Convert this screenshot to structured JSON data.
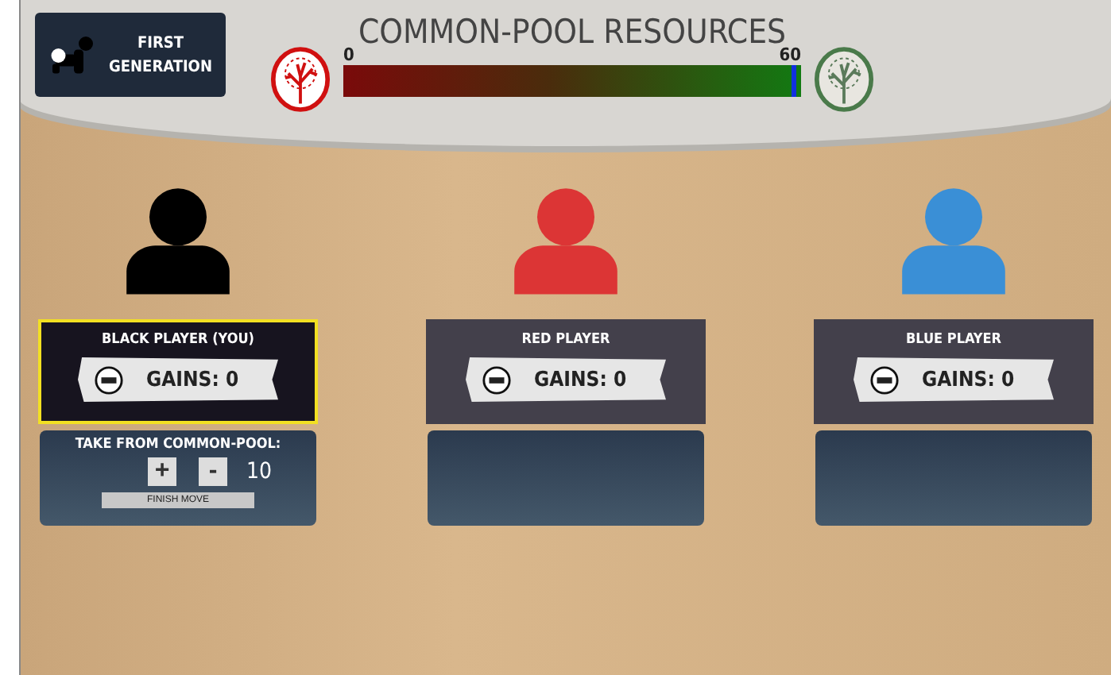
{
  "badge": {
    "title": "FIRST GENERATION"
  },
  "header": {
    "title": "COMMON-POOL RESOURCES",
    "min_label": "0",
    "max_label": "60",
    "level": 0.99
  },
  "players": [
    {
      "name": "BLACK PLAYER (YOU)",
      "gains": "GAINS: 0",
      "color": "#000000",
      "selected": true,
      "controls": {
        "label": "TAKE FROM COMMON-POOL:",
        "plus": "+",
        "minus": "-",
        "amount": "10",
        "finish": "FINISH MOVE"
      }
    },
    {
      "name": "RED PLAYER",
      "gains": "GAINS: 0",
      "color": "#dc3535",
      "selected": false
    },
    {
      "name": "BLUE PLAYER",
      "gains": "GAINS: 0",
      "color": "#3a8fd6",
      "selected": false
    }
  ]
}
